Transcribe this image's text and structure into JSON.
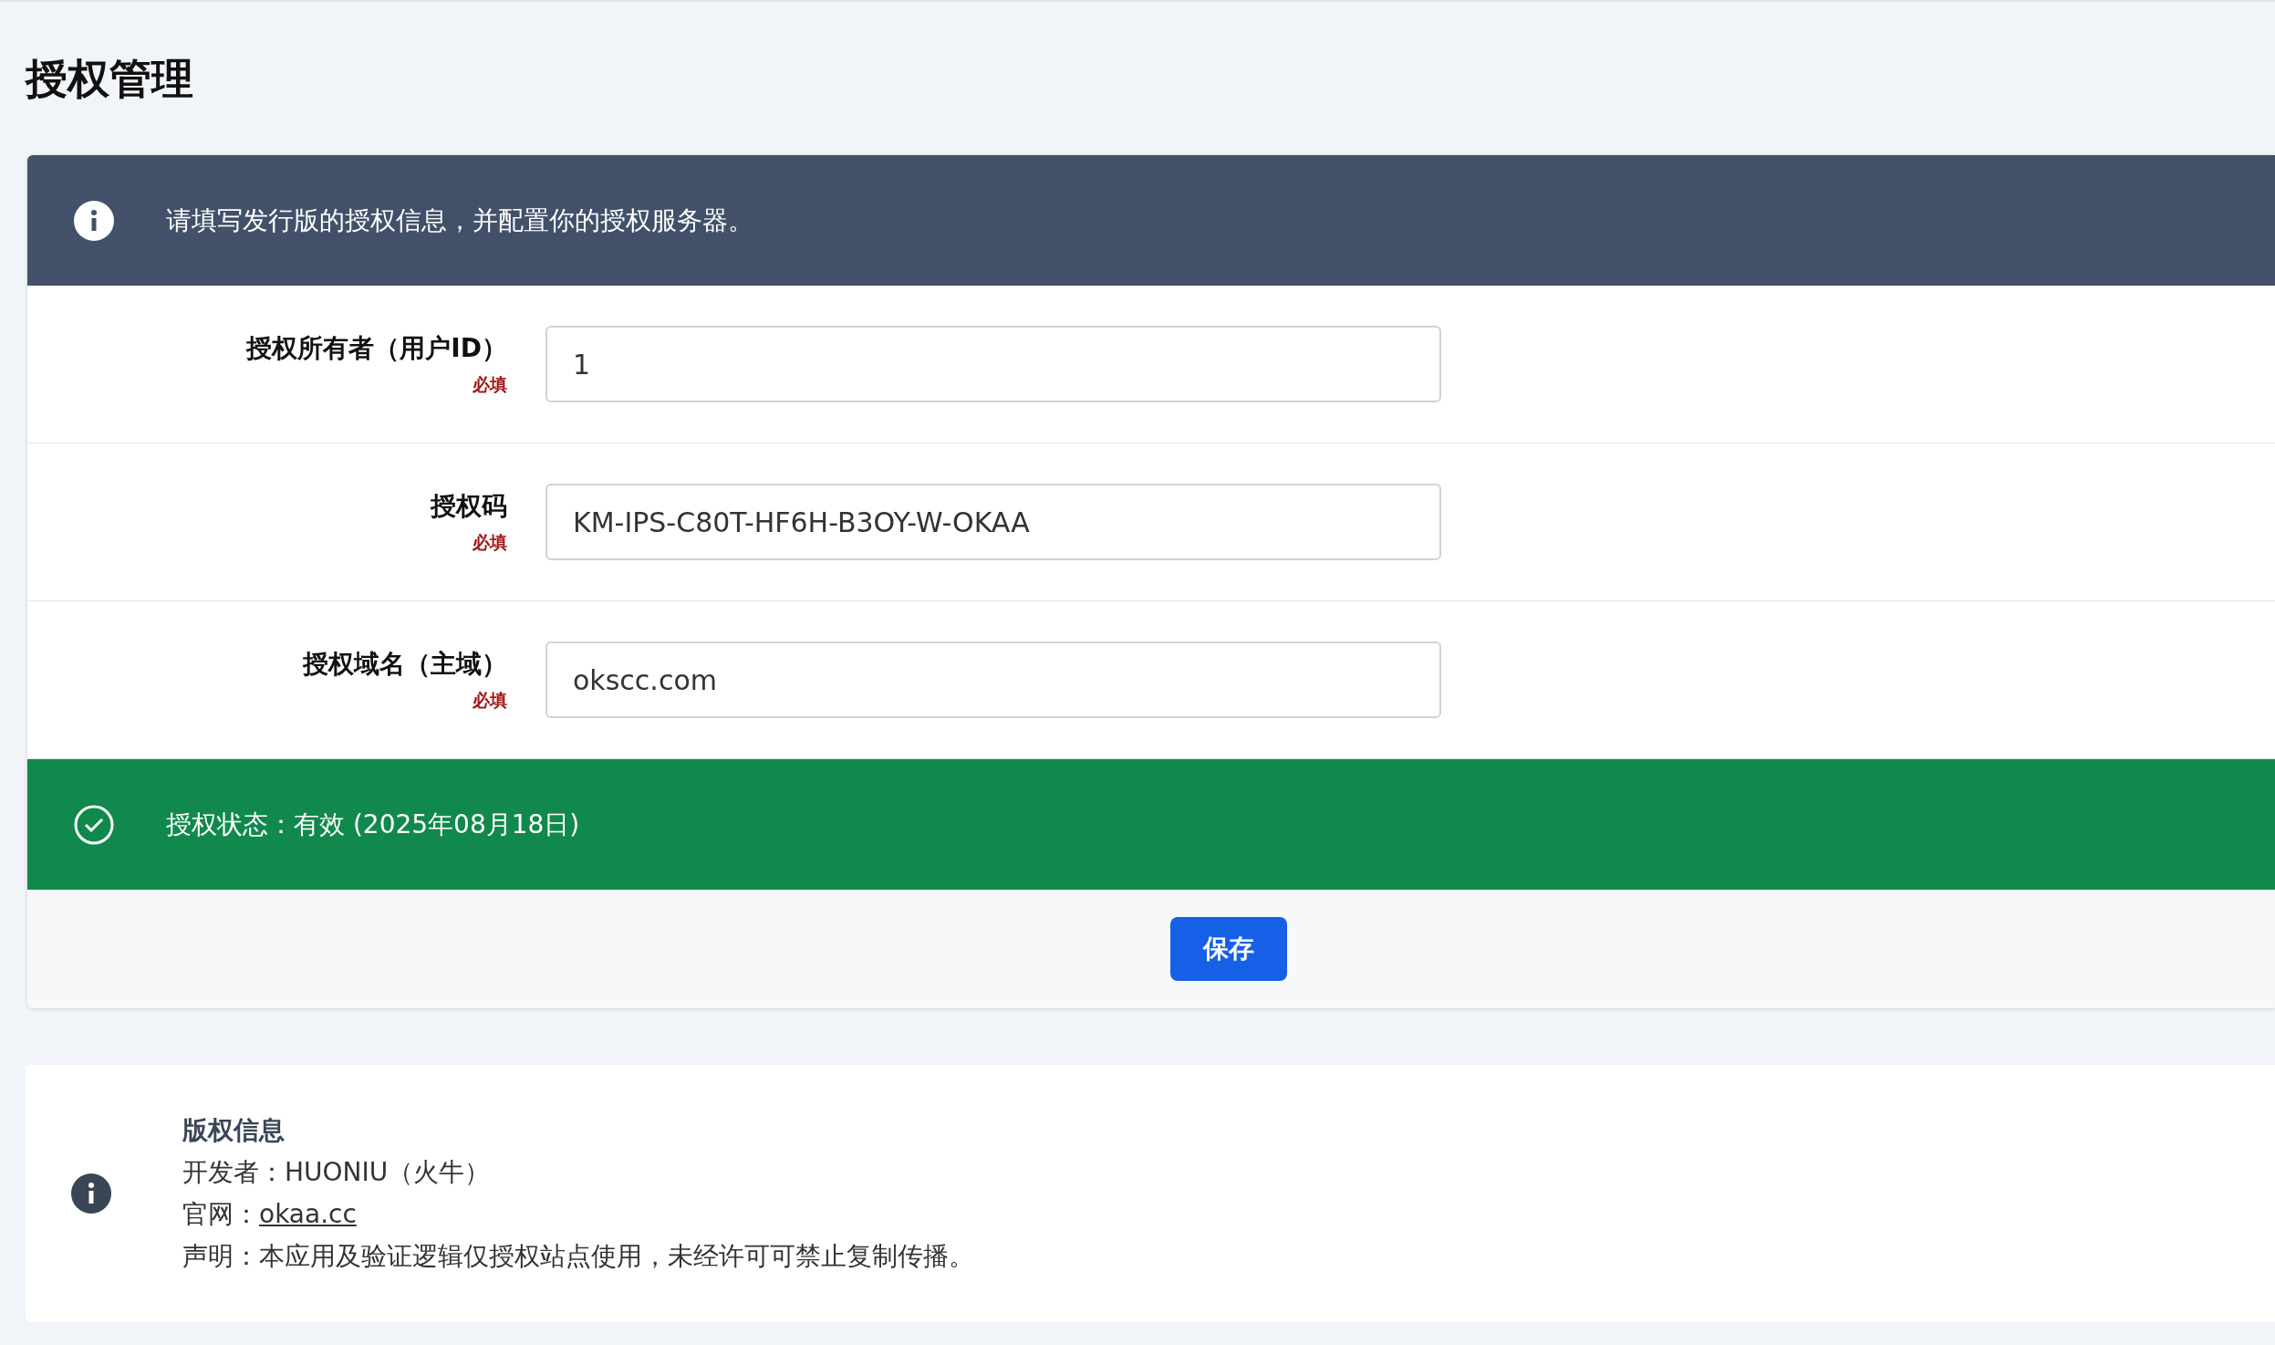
{
  "page_title": "授权管理",
  "notice": {
    "kind": "info",
    "text": "请填写发行版的授权信息，并配置你的授权服务器。"
  },
  "fields": [
    {
      "label": "授权所有者（用户ID）",
      "required_label": "必填",
      "value": "1"
    },
    {
      "label": "授权码",
      "required_label": "必填",
      "value": "KM-IPS-C80T-HF6H-B3OY-W-OKAA"
    },
    {
      "label": "授权域名（主域）",
      "required_label": "必填",
      "value": "okscc.com"
    }
  ],
  "status": {
    "kind": "success",
    "text": "授权状态：有效 (2025年08月18日)"
  },
  "save_button": "保存",
  "copyright": {
    "title": "版权信息",
    "developer": "开发者：HUONIU（火牛）",
    "website_label": "官网：",
    "website_link": "okaa.cc",
    "notice": "声明：本应用及验证逻辑仅授权站点使用，未经许可可禁止复制传播。"
  }
}
